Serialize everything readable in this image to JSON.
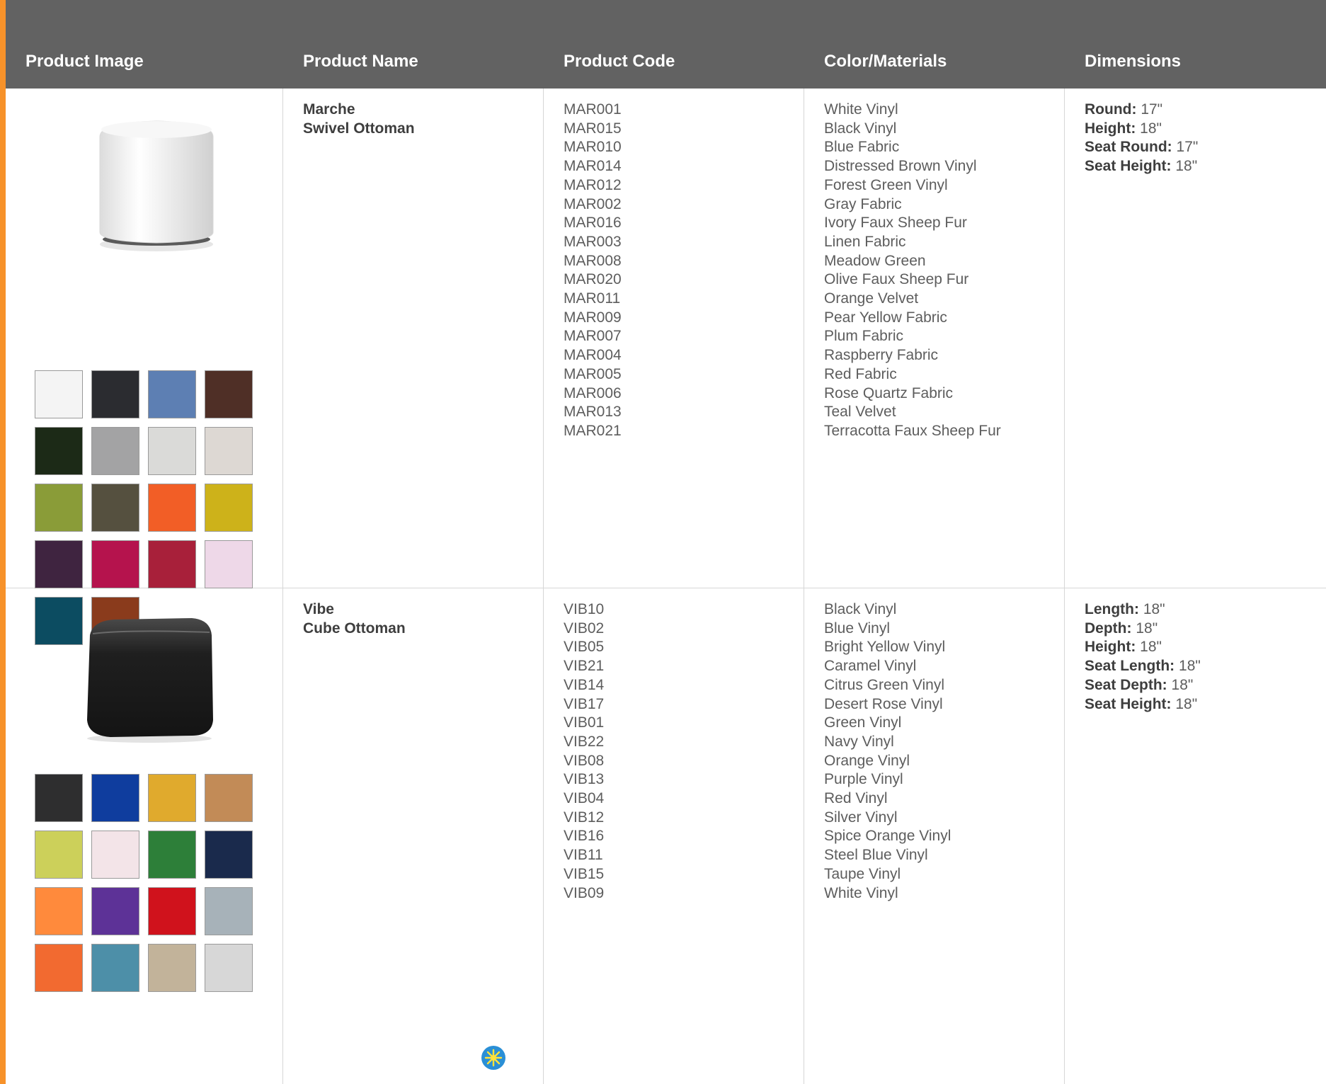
{
  "header": {
    "col_image": "Product Image",
    "col_name": "Product Name",
    "col_code": "Product Code",
    "col_colors": "Color/Materials",
    "col_dimensions": "Dimensions"
  },
  "colors": {
    "accent": "#f7922a",
    "header_bg": "#626262"
  },
  "products": [
    {
      "name_line1": "Marche",
      "name_line2": "Swivel Ottoman",
      "image_icon": "round-white-ottoman",
      "codes": [
        "MAR001",
        "MAR015",
        "MAR010",
        "MAR014",
        "MAR012",
        "MAR002",
        "MAR016",
        "MAR003",
        "MAR008",
        "MAR020",
        "MAR011",
        "MAR009",
        "MAR007",
        "MAR004",
        "MAR005",
        "MAR006",
        "MAR013",
        "MAR021"
      ],
      "materials": [
        "White Vinyl",
        "Black Vinyl",
        "Blue Fabric",
        "Distressed Brown Vinyl",
        "Forest Green Vinyl",
        "Gray Fabric",
        "Ivory Faux Sheep Fur",
        "Linen Fabric",
        "Meadow Green",
        "Olive Faux Sheep Fur",
        "Orange Velvet",
        "Pear Yellow Fabric",
        "Plum Fabric",
        "Raspberry Fabric",
        "Red Fabric",
        "Rose Quartz Fabric",
        "Teal Velvet",
        "Terracotta Faux Sheep Fur"
      ],
      "swatches": [
        "#f4f4f4",
        "#2b2c30",
        "#5d7fb3",
        "#4f2f26",
        "#1c2a17",
        "#a3a3a4",
        "#dadad8",
        "#ddd8d3",
        "#8a9c38",
        "#55503f",
        "#f25e26",
        "#cdb21a",
        "#3f2440",
        "#b5134d",
        "#a8203a",
        "#eed8e8",
        "#0c4c61",
        "#8a3b1c"
      ],
      "dimensions": [
        {
          "label": "Round:",
          "value": "17\""
        },
        {
          "label": "Height:",
          "value": "18\""
        },
        {
          "label": "Seat Round:",
          "value": "17\""
        },
        {
          "label": "Seat Height:",
          "value": "18\""
        }
      ]
    },
    {
      "name_line1": "Vibe",
      "name_line2": "Cube Ottoman",
      "image_icon": "black-cube-ottoman",
      "codes": [
        "VIB10",
        "VIB02",
        "VIB05",
        "VIB21",
        "VIB14",
        "VIB17",
        "VIB01",
        "VIB22",
        "VIB08",
        "VIB13",
        "VIB04",
        "VIB12",
        "VIB16",
        "VIB11",
        "VIB15",
        "VIB09"
      ],
      "materials": [
        "Black Vinyl",
        "Blue Vinyl",
        "Bright Yellow Vinyl",
        "Caramel Vinyl",
        "Citrus Green Vinyl",
        "Desert Rose Vinyl",
        "Green Vinyl",
        "Navy Vinyl",
        "Orange Vinyl",
        "Purple Vinyl",
        "Red Vinyl",
        "Silver Vinyl",
        "Spice Orange Vinyl",
        "Steel Blue Vinyl",
        "Taupe Vinyl",
        "White Vinyl"
      ],
      "swatches": [
        "#2e2e2f",
        "#0f3d9e",
        "#e0aa2d",
        "#c28b57",
        "#ccd05a",
        "#f3e4e8",
        "#2d7f39",
        "#1a2a4c",
        "#ff8a3c",
        "#5d3297",
        "#d0121c",
        "#a7b2b9",
        "#f26a30",
        "#4d8fa8",
        "#c2b39a",
        "#d7d7d7"
      ],
      "dimensions": [
        {
          "label": "Length:",
          "value": "18\""
        },
        {
          "label": "Depth:",
          "value": "18\""
        },
        {
          "label": "Height:",
          "value": "18\""
        },
        {
          "label": "Seat Length:",
          "value": "18\""
        },
        {
          "label": "Seat Depth:",
          "value": "18\""
        },
        {
          "label": "Seat Height:",
          "value": "18\""
        }
      ]
    }
  ],
  "badge_icon": "sparkle-badge-icon"
}
